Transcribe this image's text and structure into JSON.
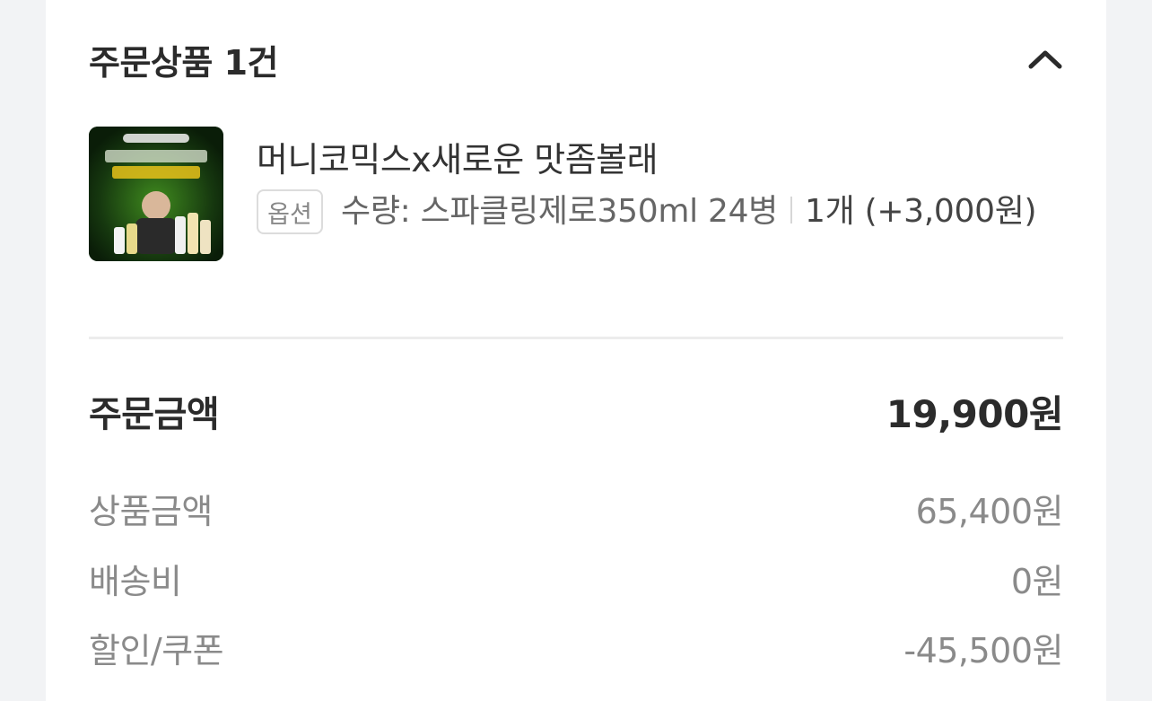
{
  "order_section": {
    "title": "주문상품 1건",
    "collapse_icon": "chevron-up-icon"
  },
  "product": {
    "name": "머니코믹스x새로운 맛좀볼래",
    "option_badge": "옵션",
    "option_text": "수량: 스파클링제로350ml 24병",
    "option_quantity": "1개 (+3,000원)",
    "thumbnail_icon": "product-thumbnail",
    "thumbnail_colors": {
      "background": "#0f2a0c",
      "glow": "#3f8a1e",
      "accent": "#e8c21a"
    }
  },
  "summary": {
    "total_label": "주문금액",
    "total_value": "19,900원",
    "rows": [
      {
        "label": "상품금액",
        "value": "65,400원"
      },
      {
        "label": "배송비",
        "value": "0원"
      },
      {
        "label": "할인/쿠폰",
        "value": "-45,500원"
      }
    ]
  }
}
